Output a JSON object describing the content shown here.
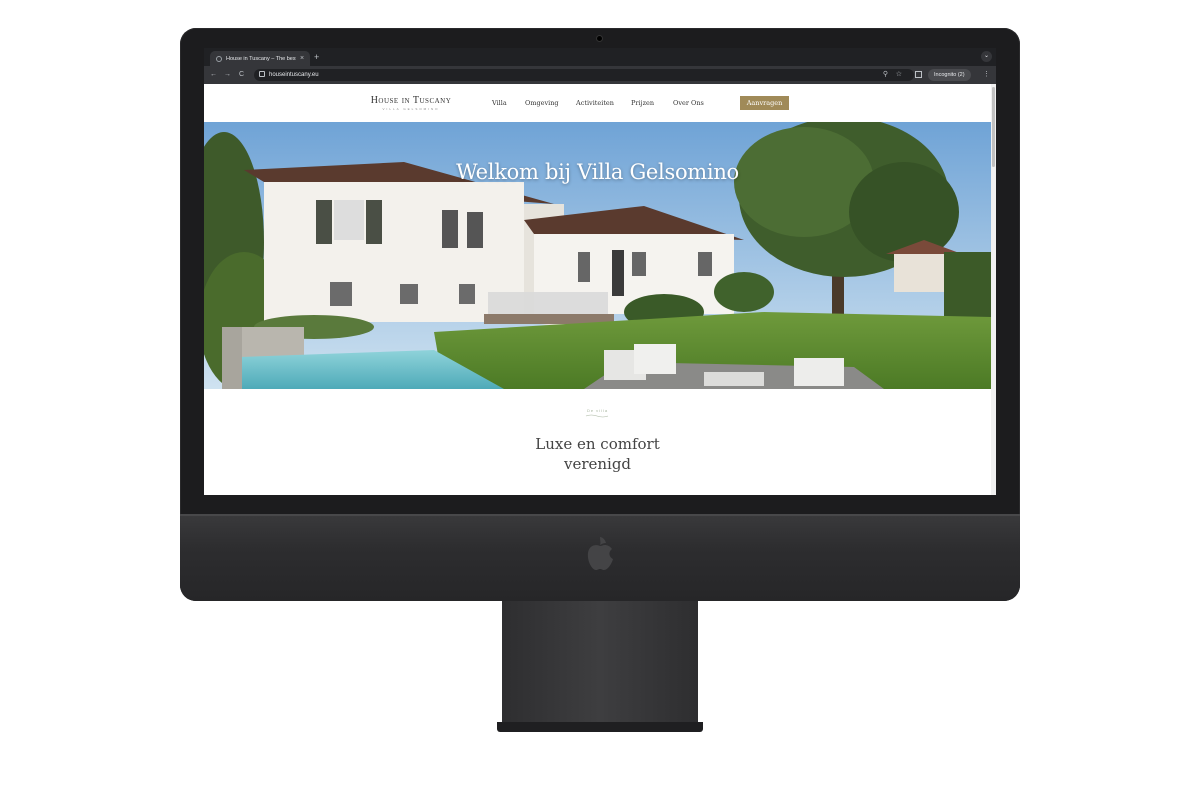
{
  "browser": {
    "tab_title": "House in Tuscany – The best",
    "tab_close": "×",
    "new_tab": "+",
    "tab_search": "⌄",
    "nav_back": "←",
    "nav_forward": "→",
    "nav_reload": "C",
    "url": "houseintuscany.eu",
    "zoom": "⚲",
    "star": "☆",
    "incognito_label": "Incognito (2)",
    "menu": "⋮"
  },
  "site": {
    "logo": "House in Tuscany",
    "logo_sub": "VILLA GELSOMINO",
    "nav": [
      {
        "label": "Villa"
      },
      {
        "label": "Omgeving"
      },
      {
        "label": "Activiteiten"
      },
      {
        "label": "Prijzen"
      },
      {
        "label": "Over Ons"
      }
    ],
    "cta_label": "Aanvragen",
    "hero_title": "Welkom bij Villa Gelsomino",
    "intro_eyebrow": "De villa",
    "intro_heading_line1": "Luxe en comfort",
    "intro_heading_line2": "verenigd"
  },
  "colors": {
    "cta": "#a08a58",
    "browser_bg": "#202124",
    "toolbar_bg": "#35363a"
  }
}
